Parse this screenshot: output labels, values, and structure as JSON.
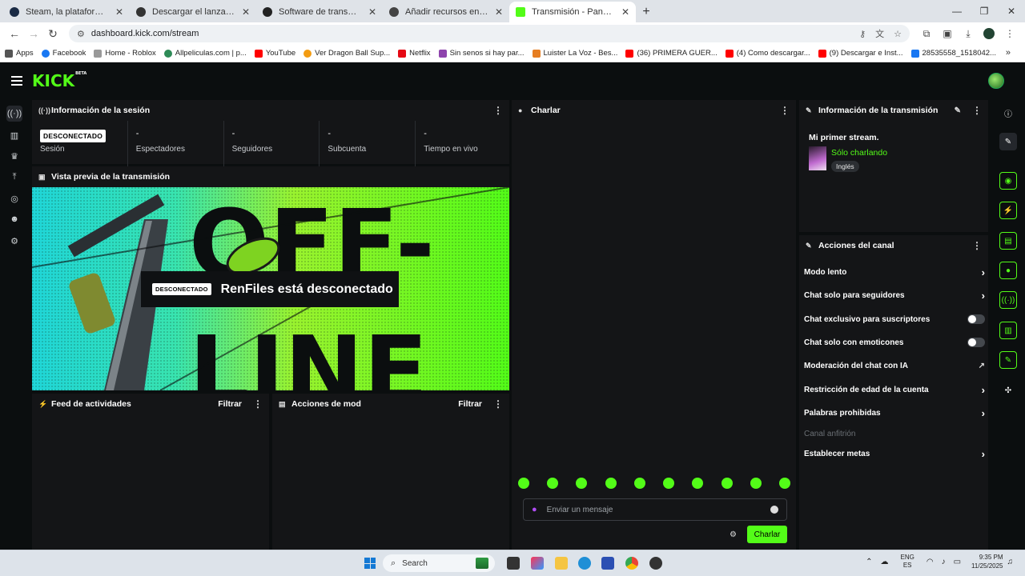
{
  "browser": {
    "tabs": [
      {
        "title": "Steam, la plataforma de juegos",
        "active": false
      },
      {
        "title": "Descargar el lanzador de Epic G",
        "active": false
      },
      {
        "title": "Software de transmisión abierta",
        "active": false
      },
      {
        "title": "Añadir recursos en OBS",
        "active": false
      },
      {
        "title": "Transmisión - Panel de control d",
        "active": true
      }
    ],
    "url": "dashboard.kick.com/stream",
    "bookmarks": [
      {
        "label": "Apps",
        "color": "#555555"
      },
      {
        "label": "Facebook",
        "color": "#1877f2"
      },
      {
        "label": "Home - Roblox",
        "color": "#999999"
      },
      {
        "label": "Allpeliculas.com | p...",
        "color": "#2e8b57"
      },
      {
        "label": "YouTube",
        "color": "#ff0000"
      },
      {
        "label": "Ver Dragon Ball Sup...",
        "color": "#f39c12"
      },
      {
        "label": "Netflix",
        "color": "#e50914"
      },
      {
        "label": "Sin senos si hay par...",
        "color": "#8e44ad"
      },
      {
        "label": "Luister La Voz - Bes...",
        "color": "#e67e22"
      },
      {
        "label": "(36) PRIMERA GUER...",
        "color": "#ff0000"
      },
      {
        "label": "(4) Como descargar...",
        "color": "#ff0000"
      },
      {
        "label": "(9) Descargar e Inst...",
        "color": "#ff0000"
      },
      {
        "label": "28535558_1518042...",
        "color": "#1877f2"
      }
    ]
  },
  "kick": {
    "logo": "KICK",
    "logo_beta": "BETA",
    "accent": "#53fc18"
  },
  "session": {
    "title": "Información de la sesión",
    "status_badge": "DESCONECTADO",
    "stats": [
      {
        "value": "",
        "label": "Sesión"
      },
      {
        "value": "-",
        "label": "Espectadores"
      },
      {
        "value": "-",
        "label": "Seguidores"
      },
      {
        "value": "-",
        "label": "Subcuenta"
      },
      {
        "value": "-",
        "label": "Tiempo en vivo"
      }
    ]
  },
  "preview": {
    "title": "Vista previa de la transmisión",
    "banner_badge": "DESCONECTADO",
    "banner_text": "RenFiles está desconectado",
    "bg_text_top": "OFF-",
    "bg_text_bottom": "LINE"
  },
  "activity": {
    "title": "Feed de actividades",
    "filter": "Filtrar"
  },
  "modactions": {
    "title": "Acciones de mod",
    "filter": "Filtrar"
  },
  "chat": {
    "title": "Charlar",
    "placeholder": "Enviar un mensaje",
    "send_label": "Charlar",
    "emote_count": 10
  },
  "stream_info": {
    "title": "Información de la transmisión",
    "stream_title": "Mi primer stream.",
    "category": "Sólo charlando",
    "tag": "Inglés"
  },
  "channel_actions": {
    "title": "Acciones del canal",
    "items": [
      {
        "label": "Modo lento",
        "control": "chevron"
      },
      {
        "label": "Chat solo para seguidores",
        "control": "chevron"
      },
      {
        "label": "Chat exclusivo para suscriptores",
        "control": "toggle",
        "on": false
      },
      {
        "label": "Chat solo con emoticones",
        "control": "toggle",
        "on": false
      },
      {
        "label": "Moderación del chat con IA",
        "control": "external"
      },
      {
        "label": "Restricción de edad de la cuenta",
        "control": "chevron"
      },
      {
        "label": "Palabras prohibidas",
        "control": "chevron"
      },
      {
        "label": "Canal anfitrión",
        "control": "none",
        "disabled": true
      },
      {
        "label": "Establecer metas",
        "control": "chevron"
      }
    ]
  },
  "taskbar": {
    "search_label": "Search",
    "lang_top": "ENG",
    "lang_bottom": "ES",
    "time": "9:35 PM",
    "date": "11/25/2025"
  }
}
